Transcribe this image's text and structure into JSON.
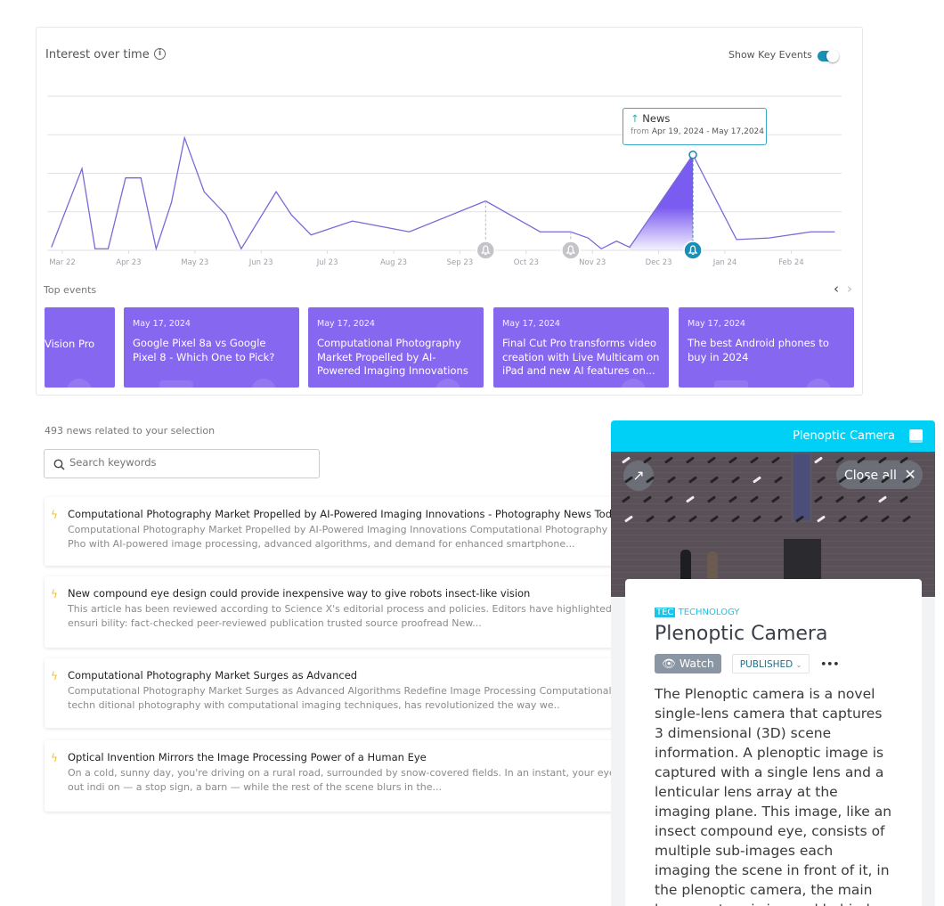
{
  "chart_panel": {
    "title": "Interest over time",
    "info_icon": "info-circle-icon",
    "show_key_events_label": "Show Key Events",
    "show_key_events_on": true,
    "tooltip": {
      "label": "News",
      "from_label": "from",
      "range": "Apr 19, 2024 - May 17,2024"
    },
    "top_events_label": "Top events"
  },
  "chart_data": {
    "type": "line",
    "x_tick_labels": [
      "Mar 22",
      "Apr 23",
      "May 23",
      "Jun 23",
      "Jul 23",
      "Aug 23",
      "Sep 23",
      "Oct 23",
      "Nov 23",
      "Dec 23",
      "Jan 24",
      "Feb 24"
    ],
    "ylim": [
      0,
      100
    ],
    "grid": true,
    "color": "#7b68d9",
    "highlight_color": "#7b5cf0",
    "points": [
      [
        "2023-02-24",
        2
      ],
      [
        "2023-03-10",
        53
      ],
      [
        "2023-03-16",
        1
      ],
      [
        "2023-03-22",
        1
      ],
      [
        "2023-03-30",
        47
      ],
      [
        "2023-04-06",
        47
      ],
      [
        "2023-04-13",
        1
      ],
      [
        "2023-04-20",
        31
      ],
      [
        "2023-04-26",
        73
      ],
      [
        "2023-05-05",
        38
      ],
      [
        "2023-05-15",
        23
      ],
      [
        "2023-05-22",
        1
      ],
      [
        "2023-06-07",
        38
      ],
      [
        "2023-06-14",
        23
      ],
      [
        "2023-06-23",
        10
      ],
      [
        "2023-07-12",
        19
      ],
      [
        "2023-08-07",
        12
      ],
      [
        "2023-09-11",
        32
      ],
      [
        "2023-10-06",
        12
      ],
      [
        "2023-10-20",
        12
      ],
      [
        "2023-10-28",
        8
      ],
      [
        "2023-11-03",
        1
      ],
      [
        "2023-11-10",
        6
      ],
      [
        "2023-11-16",
        2
      ],
      [
        "2023-12-15",
        62
      ],
      [
        "2024-01-04",
        7
      ],
      [
        "2024-01-19",
        8
      ],
      [
        "2024-02-07",
        12
      ],
      [
        "2024-02-18",
        12
      ]
    ],
    "highlight_range": [
      "2023-11-16",
      "2023-12-15"
    ],
    "key_events": [
      {
        "date": "2023-09-11",
        "active": false
      },
      {
        "date": "2023-10-20",
        "active": false
      },
      {
        "date": "2023-12-15",
        "active": true
      }
    ]
  },
  "top_events": [
    {
      "date": "",
      "title": "Vision Pro"
    },
    {
      "date": "May 17, 2024",
      "title": "Google Pixel 8a vs Google Pixel 8 - Which One to Pick?"
    },
    {
      "date": "May 17, 2024",
      "title": "Computational Photography Market Propelled by AI-Powered Imaging Innovations"
    },
    {
      "date": "May 17, 2024",
      "title": "Final Cut Pro transforms video creation with Live Multicam on iPad and new AI features on..."
    },
    {
      "date": "May 17, 2024",
      "title": "The best Android phones to buy in 2024"
    }
  ],
  "news": {
    "count_label": "493 news related to your selection",
    "search_placeholder": "Search keywords",
    "items": [
      {
        "title": "Computational Photography Market Propelled by AI-Powered Imaging Innovations - Photography News Today",
        "line1": "Computational Photography Market Propelled by AI-Powered Imaging Innovations Computational Photography M",
        "line2": "Pho with AI-powered image processing, advanced algorithms, and demand for enhanced smartphone..."
      },
      {
        "title": "New compound eye design could provide inexpensive way to give robots insect-like vision",
        "line1": "This article has been reviewed according to Science X's editorial process and policies. Editors have highlighted the",
        "line2": "ensuri bility: fact-checked peer-reviewed publication trusted source proofread New..."
      },
      {
        "title": "Computational Photography Market Surges as Advanced",
        "line1": "Computational Photography Market Surges as Advanced Algorithms Redefine Image Processing Computational ph",
        "line2": "techn ditional photography with computational imaging techniques, has revolutionized the way we.."
      },
      {
        "title": "Optical Invention Mirrors the Image Processing Power of a Human Eye",
        "line1": "On a cold, sunny day, you're driving on a rural road, surrounded by snow-covered fields. In an instant, your eyes p",
        "line2": "out indi on — a stop sign, a barn — while the rest of the scene blurs in the..."
      }
    ]
  },
  "side_panel": {
    "header_title": "Plenoptic Camera",
    "close_all_label": "Close all",
    "category_code": "TEC",
    "category": "TECHNOLOGY",
    "title": "Plenoptic Camera",
    "watch_label": "Watch",
    "status_label": "PUBLISHED",
    "more_label": "•••",
    "body": "The Plenoptic camera is a novel single-lens camera that captures 3 dimensional (3D) scene information. A plenoptic image is captured with a single lens and a lenticular lens array at the imaging plane. This image, like an insect compound eye, consists of multiple sub-images each imaging the scene in front of it, in the plenoptic camera, the main lens aperture is imaged behind each lenslet",
    "accent": "#00d0f5"
  }
}
